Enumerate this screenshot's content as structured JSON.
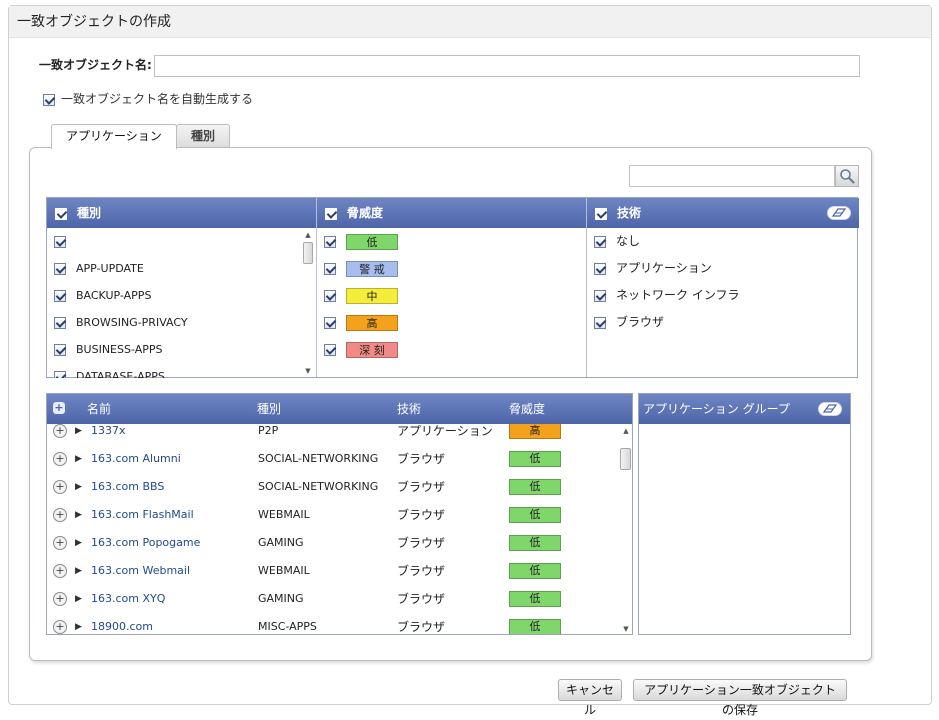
{
  "dialog": {
    "title": "一致オブジェクトの作成",
    "name_label": "一致オブジェクト名:",
    "name_value": "",
    "autogen_label": "一致オブジェクト名を自動生成する"
  },
  "tabs": [
    {
      "label": "アプリケーション",
      "active": true
    },
    {
      "label": "種別",
      "active": false
    }
  ],
  "search": {
    "value": "",
    "icon": "magnifier-icon"
  },
  "filters": {
    "category": {
      "header": "種別",
      "items": [
        "",
        "APP-UPDATE",
        "BACKUP-APPS",
        "BROWSING-PRIVACY",
        "BUSINESS-APPS",
        "DATABASE-APPS"
      ]
    },
    "threat": {
      "header": "脅威度",
      "items": [
        {
          "label": "低",
          "color": "#7fd66b"
        },
        {
          "label": "警 戒",
          "color": "#a7bdf0"
        },
        {
          "label": "中",
          "color": "#f4ee3a"
        },
        {
          "label": "高",
          "color": "#f4a11c"
        },
        {
          "label": "深 刻",
          "color": "#f08a86"
        }
      ]
    },
    "technology": {
      "header": "技術",
      "items": [
        "なし",
        "アプリケーション",
        "ネットワーク インフラ",
        "ブラウザ"
      ]
    }
  },
  "apps": {
    "columns": {
      "name": "名前",
      "category": "種別",
      "technology": "技術",
      "threat": "脅威度"
    },
    "rows": [
      {
        "name": "1337x",
        "category": "P2P",
        "technology": "アプリケーション",
        "threat": "高",
        "color": "#f4a11c"
      },
      {
        "name": "163.com Alumni",
        "category": "SOCIAL-NETWORKING",
        "technology": "ブラウザ",
        "threat": "低",
        "color": "#7fd66b"
      },
      {
        "name": "163.com BBS",
        "category": "SOCIAL-NETWORKING",
        "technology": "ブラウザ",
        "threat": "低",
        "color": "#7fd66b"
      },
      {
        "name": "163.com FlashMail",
        "category": "WEBMAIL",
        "technology": "ブラウザ",
        "threat": "低",
        "color": "#7fd66b"
      },
      {
        "name": "163.com Popogame",
        "category": "GAMING",
        "technology": "ブラウザ",
        "threat": "低",
        "color": "#7fd66b"
      },
      {
        "name": "163.com Webmail",
        "category": "WEBMAIL",
        "technology": "ブラウザ",
        "threat": "低",
        "color": "#7fd66b"
      },
      {
        "name": "163.com XYQ",
        "category": "GAMING",
        "technology": "ブラウザ",
        "threat": "低",
        "color": "#7fd66b"
      },
      {
        "name": "18900.com",
        "category": "MISC-APPS",
        "technology": "ブラウザ",
        "threat": "低",
        "color": "#7fd66b"
      }
    ]
  },
  "groups": {
    "header": "アプリケーション グループ"
  },
  "buttons": {
    "cancel": "キャンセル",
    "save": "アプリケーション一致オブジェクトの保存"
  }
}
